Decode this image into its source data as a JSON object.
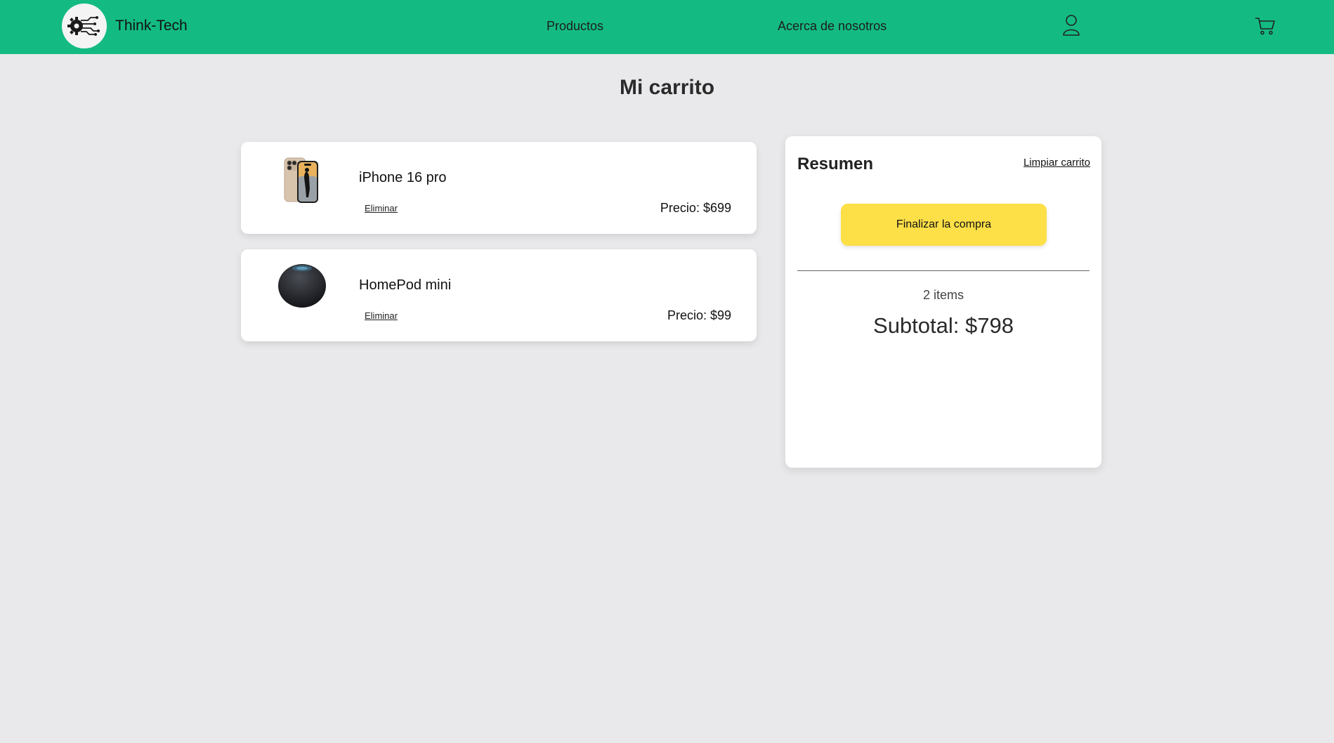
{
  "navbar": {
    "brand": "Think-Tech",
    "links": [
      "Productos",
      "Acerca de nosotros"
    ],
    "icons": [
      "user-icon",
      "cart-icon"
    ],
    "background": "#13bb82"
  },
  "page": {
    "title": "Mi carrito"
  },
  "cart": {
    "items": [
      {
        "name": "iPhone 16 pro",
        "remove_label": "Eliminar",
        "price_label": "Precio: $699",
        "image": "iphone-image"
      },
      {
        "name": "HomePod mini",
        "remove_label": "Eliminar",
        "price_label": "Precio: $99",
        "image": "homepod-image"
      }
    ]
  },
  "summary": {
    "title": "Resumen",
    "clear_label": "Limpiar carrito",
    "checkout_label": "Finalizar la compra",
    "checkout_color": "#fddf47",
    "items_count": "2 items",
    "subtotal": "Subtotal: $798"
  }
}
